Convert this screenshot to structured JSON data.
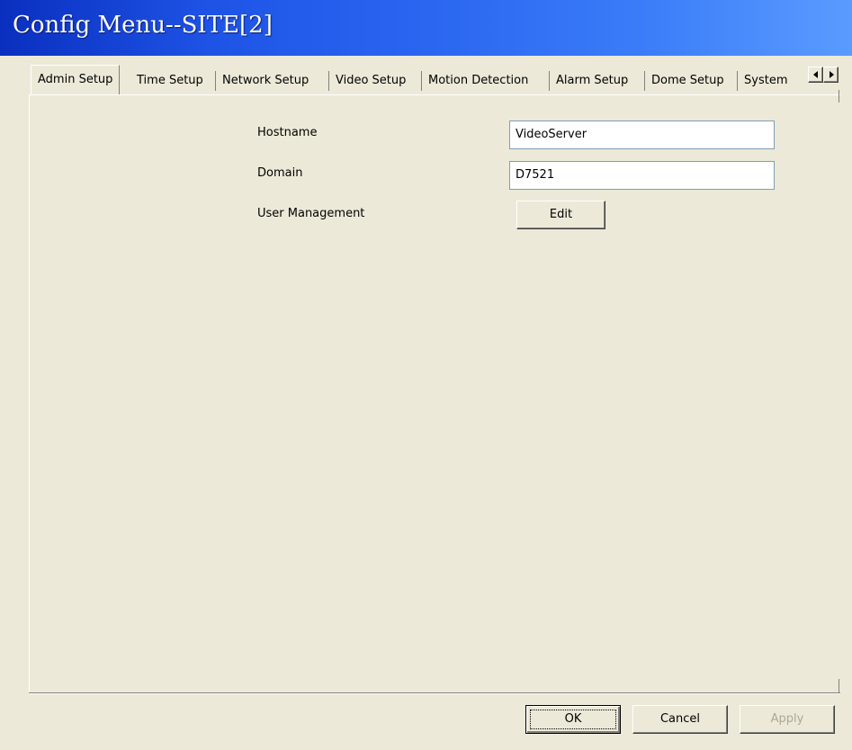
{
  "window": {
    "title": "Config Menu--SITE[2]"
  },
  "tabs": [
    {
      "label": "Admin Setup",
      "active": true
    },
    {
      "label": "Time Setup"
    },
    {
      "label": "Network Setup"
    },
    {
      "label": "Video Setup"
    },
    {
      "label": "Motion Detection"
    },
    {
      "label": "Alarm Setup"
    },
    {
      "label": "Dome Setup"
    },
    {
      "label": "System"
    }
  ],
  "tab_scroll": {
    "left_icon": "arrow-left-icon",
    "right_icon": "arrow-right-icon"
  },
  "form": {
    "hostname_label": "Hostname",
    "hostname_value": "VideoServer",
    "domain_label": "Domain",
    "domain_value": "D7521",
    "user_mgmt_label": "User Management",
    "edit_button": "Edit"
  },
  "footer": {
    "ok": "OK",
    "cancel": "Cancel",
    "apply": "Apply"
  }
}
